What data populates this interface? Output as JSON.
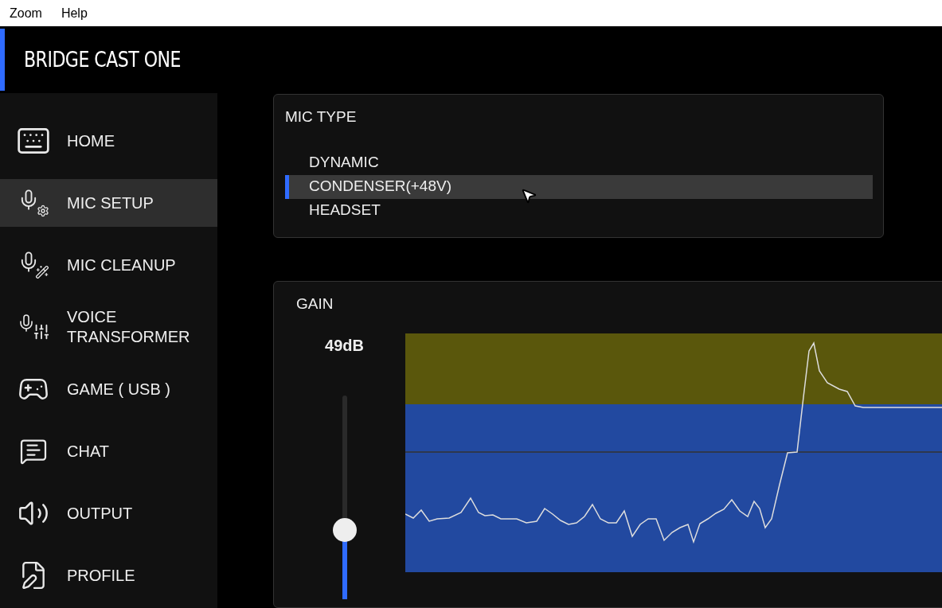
{
  "menu_bar": [
    "Zoom",
    "Help"
  ],
  "app_title": "BRIDGE CAST ONE",
  "sidebar": {
    "items": [
      {
        "label": "HOME",
        "selected": false
      },
      {
        "label": "MIC SETUP",
        "selected": true
      },
      {
        "label": "MIC CLEANUP",
        "selected": false
      },
      {
        "label": "VOICE TRANSFORMER",
        "selected": false
      },
      {
        "label": "GAME ( USB )",
        "selected": false
      },
      {
        "label": "CHAT",
        "selected": false
      },
      {
        "label": "OUTPUT",
        "selected": false
      },
      {
        "label": "PROFILE",
        "selected": false
      }
    ]
  },
  "mic_type": {
    "title": "MIC TYPE",
    "options": [
      {
        "label": "DYNAMIC",
        "selected": false
      },
      {
        "label": "CONDENSER(+48V)",
        "selected": true
      },
      {
        "label": "HEADSET",
        "selected": false
      }
    ]
  },
  "gain": {
    "title": "GAIN",
    "reading": "49dB",
    "level": 0.34
  }
}
